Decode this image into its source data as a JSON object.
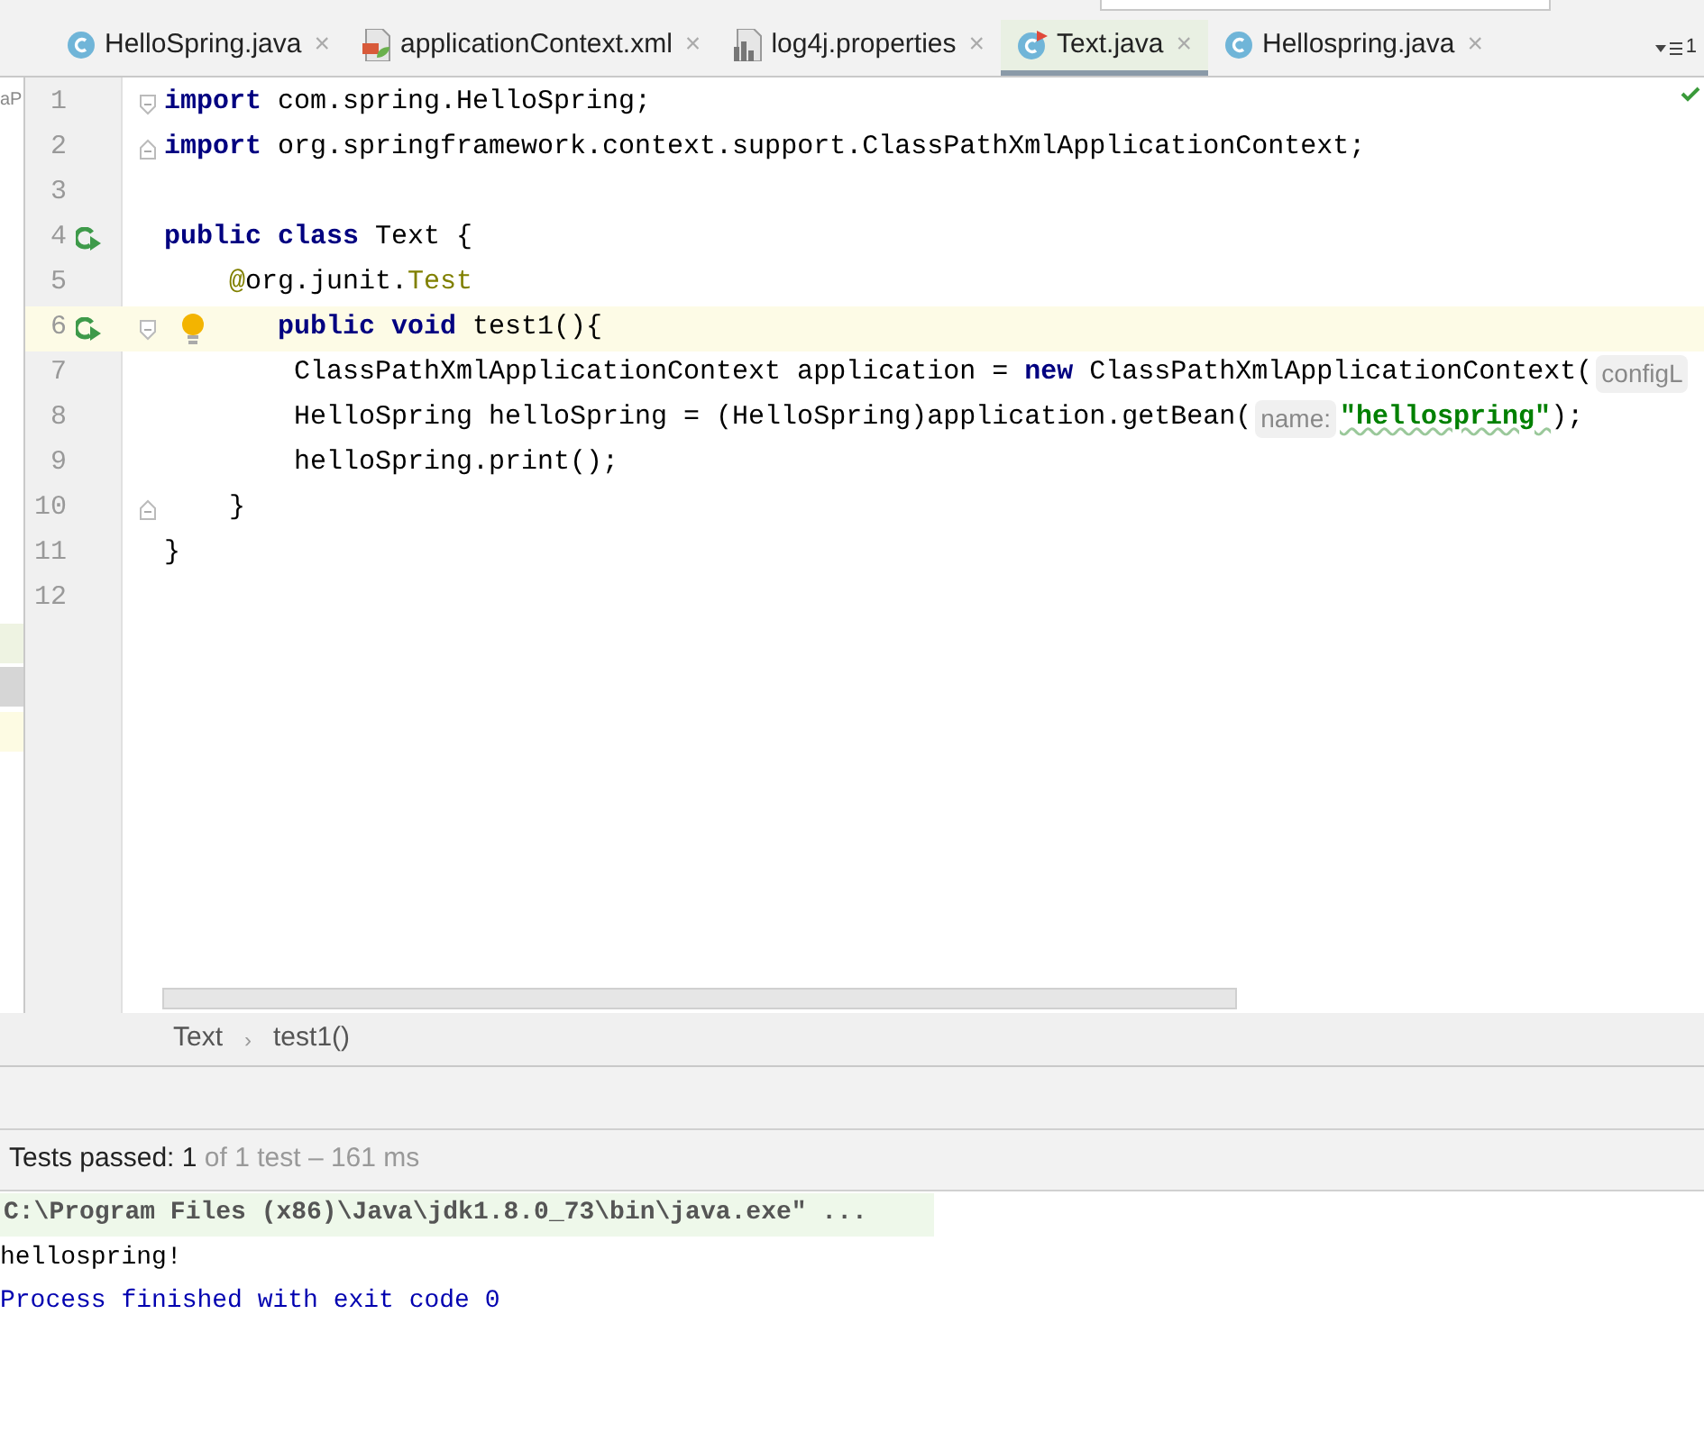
{
  "project_panel": {
    "text": "aP"
  },
  "tabs": [
    {
      "label": "HelloSpring.java",
      "kind": "class",
      "selected": false,
      "close": "×"
    },
    {
      "label": "applicationContext.xml",
      "kind": "xml",
      "selected": false,
      "close": "×"
    },
    {
      "label": "log4j.properties",
      "kind": "properties",
      "selected": false,
      "close": "×"
    },
    {
      "label": "Text.java",
      "kind": "test",
      "selected": true,
      "close": "×"
    },
    {
      "label": "Hellospring.java",
      "kind": "class",
      "selected": false,
      "close": "×"
    }
  ],
  "tab_overflow": {
    "label": "1"
  },
  "editor": {
    "lines": [
      {
        "number": "1",
        "current": false,
        "markers": [
          {
            "kind": "foldstart"
          }
        ],
        "tokens": [
          {
            "kind": "kw",
            "text": "import"
          },
          {
            "kind": "plain",
            "text": " com.spring.HelloSpring;"
          }
        ]
      },
      {
        "number": "2",
        "current": false,
        "markers": [
          {
            "kind": "foldend"
          }
        ],
        "tokens": [
          {
            "kind": "kw",
            "text": "import"
          },
          {
            "kind": "plain",
            "text": " org.springframework.context.support.ClassPathXmlApplicationContext;"
          }
        ]
      },
      {
        "number": "3",
        "current": false
      },
      {
        "number": "4",
        "current": false,
        "markers": [
          {
            "kind": "run"
          }
        ],
        "tokens": [
          {
            "kind": "kw",
            "text": "public class"
          },
          {
            "kind": "plain",
            "text": " Text {"
          }
        ]
      },
      {
        "number": "5",
        "current": false,
        "tokens": [
          {
            "kind": "annot",
            "text": "    @"
          },
          {
            "kind": "plain",
            "text": "org.junit."
          },
          {
            "kind": "annot",
            "text": "Test"
          }
        ]
      },
      {
        "number": "6",
        "current": true,
        "markers": [
          {
            "kind": "run"
          },
          {
            "kind": "foldstart"
          },
          {
            "kind": "bulb"
          }
        ],
        "tokens": [
          {
            "kind": "kw",
            "text": "       public void"
          },
          {
            "kind": "plain",
            "text": " test1(){"
          }
        ]
      },
      {
        "number": "7",
        "current": false,
        "tokens": [
          {
            "kind": "plain",
            "text": "        ClassPathXmlApplicationContext application = "
          },
          {
            "kind": "kw",
            "text": "new"
          },
          {
            "kind": "plain",
            "text": " ClassPathXmlApplicationContext("
          },
          {
            "kind": "hint",
            "text": "configL"
          }
        ]
      },
      {
        "number": "8",
        "current": false,
        "tokens": [
          {
            "kind": "plain",
            "text": "        HelloSpring helloSpring = (HelloSpring)application.getBean("
          },
          {
            "kind": "hint",
            "text": "name:"
          },
          {
            "kind": "str",
            "text": "\"hellospring\""
          },
          {
            "kind": "plain",
            "text": ");"
          }
        ]
      },
      {
        "number": "9",
        "current": false,
        "tokens": [
          {
            "kind": "plain",
            "text": "        helloSpring.print();"
          }
        ]
      },
      {
        "number": "10",
        "current": false,
        "markers": [
          {
            "kind": "foldend"
          }
        ],
        "tokens": [
          {
            "kind": "plain",
            "text": "    }"
          }
        ]
      },
      {
        "number": "11",
        "current": false,
        "tokens": [
          {
            "kind": "plain",
            "text": "}"
          }
        ]
      },
      {
        "number": "12",
        "current": false
      }
    ]
  },
  "breadcrumbs": [
    {
      "label": "Text"
    },
    {
      "label": "test1()"
    }
  ],
  "breadcrumb_separator": "›",
  "tests": {
    "label": "Tests passed:",
    "count": "1",
    "detail": "of 1 test – 161 ms"
  },
  "console": [
    {
      "kind": "command",
      "text": "C:\\Program Files (x86)\\Java\\jdk1.8.0_73\\bin\\java.exe\" ..."
    },
    {
      "kind": "output",
      "text": "hellospring!"
    },
    {
      "kind": "exit",
      "text": "Process finished with exit code 0"
    }
  ]
}
